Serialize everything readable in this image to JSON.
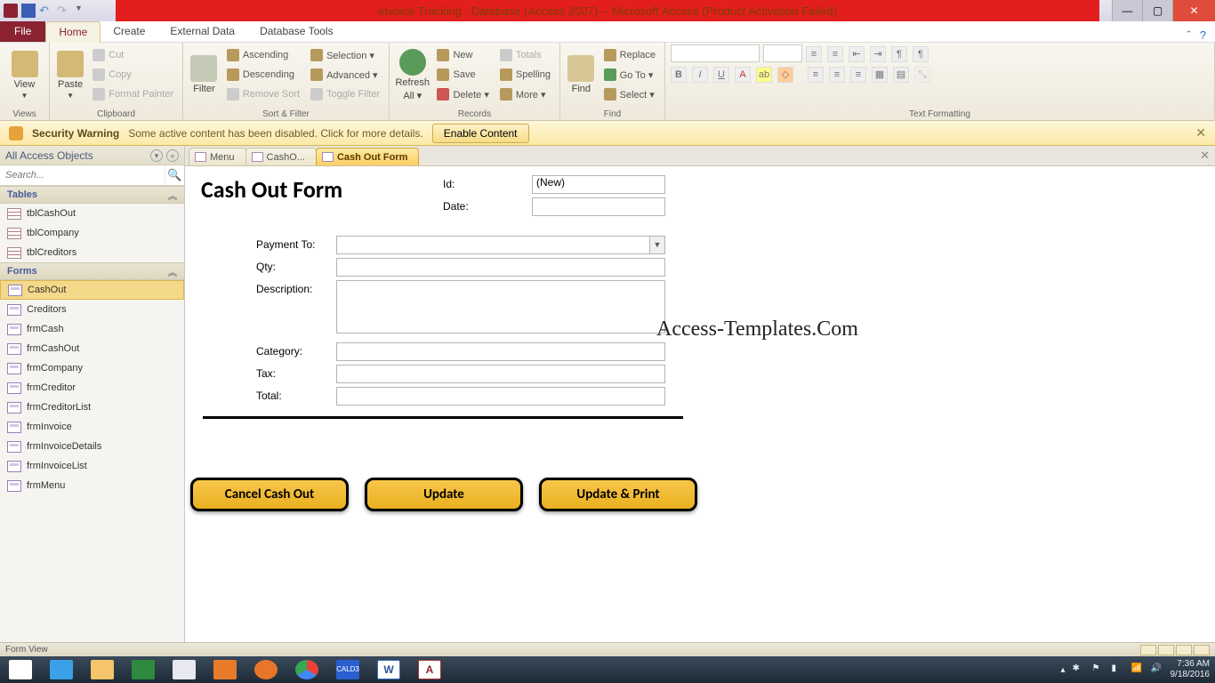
{
  "title": "Invoice Tracking : Database (Access 2007) -- Microsoft Access (Product Activation Failed)",
  "ribbon_tabs": {
    "file": "File",
    "home": "Home",
    "create": "Create",
    "external": "External Data",
    "dbtools": "Database Tools"
  },
  "ribbon": {
    "views": {
      "view": "View",
      "group": "Views"
    },
    "clipboard": {
      "paste": "Paste",
      "cut": "Cut",
      "copy": "Copy",
      "painter": "Format Painter",
      "group": "Clipboard"
    },
    "sortfilter": {
      "filter": "Filter",
      "asc": "Ascending",
      "desc": "Descending",
      "remove": "Remove Sort",
      "selection": "Selection ▾",
      "advanced": "Advanced ▾",
      "toggle": "Toggle Filter",
      "group": "Sort & Filter"
    },
    "records": {
      "refresh_l1": "Refresh",
      "refresh_l2": "All ▾",
      "new": "New",
      "save": "Save",
      "delete": "Delete ▾",
      "totals": "Totals",
      "spelling": "Spelling",
      "more": "More ▾",
      "group": "Records"
    },
    "find": {
      "find": "Find",
      "replace": "Replace",
      "goto": "Go To ▾",
      "select": "Select ▾",
      "group": "Find"
    },
    "textfmt": {
      "group": "Text Formatting"
    }
  },
  "security": {
    "title": "Security Warning",
    "msg": "Some active content has been disabled. Click for more details.",
    "enable": "Enable Content"
  },
  "nav": {
    "header": "All Access Objects",
    "search_ph": "Search...",
    "cat_tables": "Tables",
    "tables": [
      "tblCashOut",
      "tblCompany",
      "tblCreditors"
    ],
    "cat_forms": "Forms",
    "forms": [
      "CashOut",
      "Creditors",
      "frmCash",
      "frmCashOut",
      "frmCompany",
      "frmCreditor",
      "frmCreditorList",
      "frmInvoice",
      "frmInvoiceDetails",
      "frmInvoiceList",
      "frmMenu"
    ]
  },
  "doctabs": {
    "t0": "Menu",
    "t1": "CashO...",
    "t2": "Cash Out Form"
  },
  "form": {
    "title": "Cash Out Form",
    "id_lbl": "Id:",
    "id_val": "(New)",
    "date_lbl": "Date:",
    "payto_lbl": "Payment To:",
    "qty_lbl": "Qty:",
    "desc_lbl": "Description:",
    "cat_lbl": "Category:",
    "tax_lbl": "Tax:",
    "total_lbl": "Total:",
    "btn_cancel": "Cancel Cash Out",
    "btn_update": "Update",
    "btn_print": "Update & Print"
  },
  "watermark": "Access-Templates.Com",
  "status": "Form View",
  "tray": {
    "time": "7:36 AM",
    "date": "9/18/2016"
  }
}
